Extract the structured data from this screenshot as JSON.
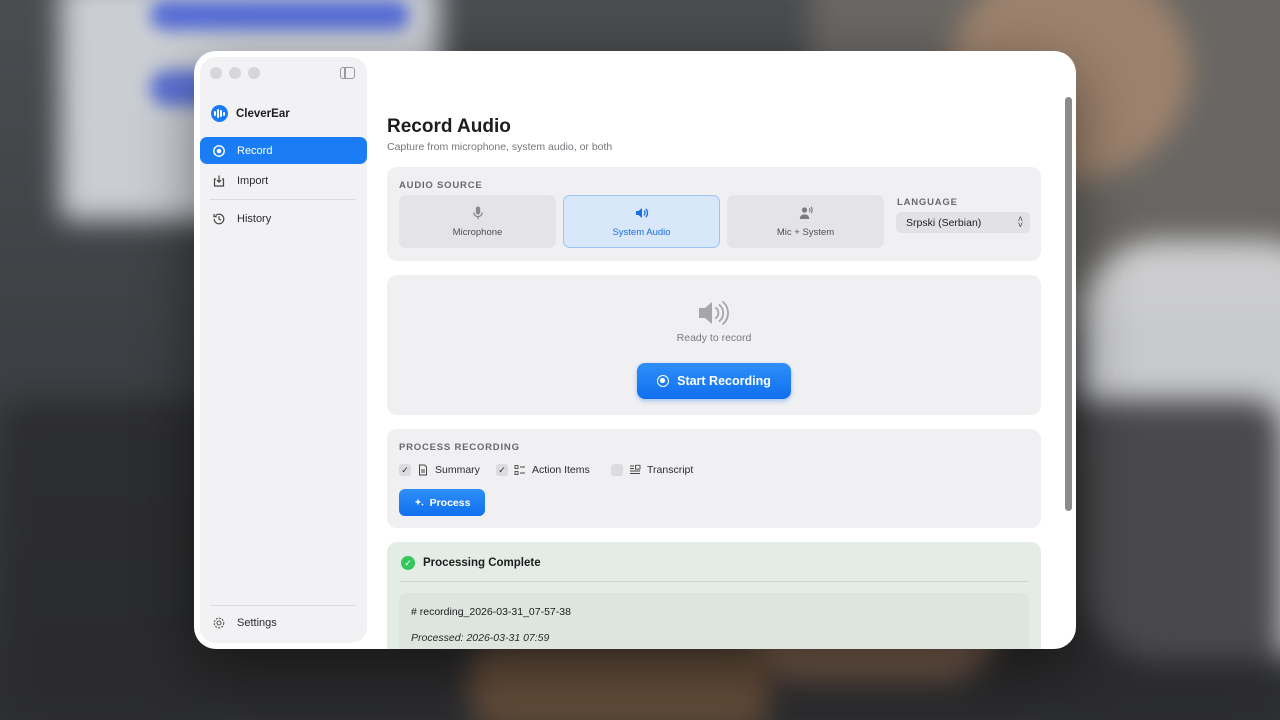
{
  "app": {
    "name": "CleverEar"
  },
  "sidebar": {
    "items": [
      {
        "label": "Record",
        "icon": "record-icon",
        "active": true
      },
      {
        "label": "Import",
        "icon": "import-icon",
        "active": false
      },
      {
        "label": "History",
        "icon": "history-icon",
        "active": false
      }
    ],
    "settings_label": "Settings"
  },
  "page": {
    "title": "Record Audio",
    "subtitle": "Capture from microphone, system audio, or both"
  },
  "audio_source": {
    "label": "AUDIO SOURCE",
    "options": [
      {
        "label": "Microphone",
        "icon": "microphone-icon",
        "selected": false
      },
      {
        "label": "System Audio",
        "icon": "speaker-icon",
        "selected": true
      },
      {
        "label": "Mic + System",
        "icon": "person-wave-icon",
        "selected": false
      }
    ],
    "language_label": "LANGUAGE",
    "language_value": "Srpski (Serbian)"
  },
  "recorder": {
    "status": "Ready to record",
    "start_label": "Start Recording"
  },
  "process": {
    "label": "PROCESS RECORDING",
    "options": [
      {
        "label": "Summary",
        "checked": true,
        "icon": "document-icon"
      },
      {
        "label": "Action Items",
        "checked": true,
        "icon": "checklist-icon"
      },
      {
        "label": "Transcript",
        "checked": false,
        "icon": "transcript-icon"
      }
    ],
    "button_label": "Process"
  },
  "result": {
    "title": "Processing Complete",
    "heading": "# recording_2026-03-31_07-57-38",
    "meta": "Processed: 2026-03-31 07:59"
  },
  "colors": {
    "accent": "#1b7df6",
    "success": "#34c759"
  }
}
